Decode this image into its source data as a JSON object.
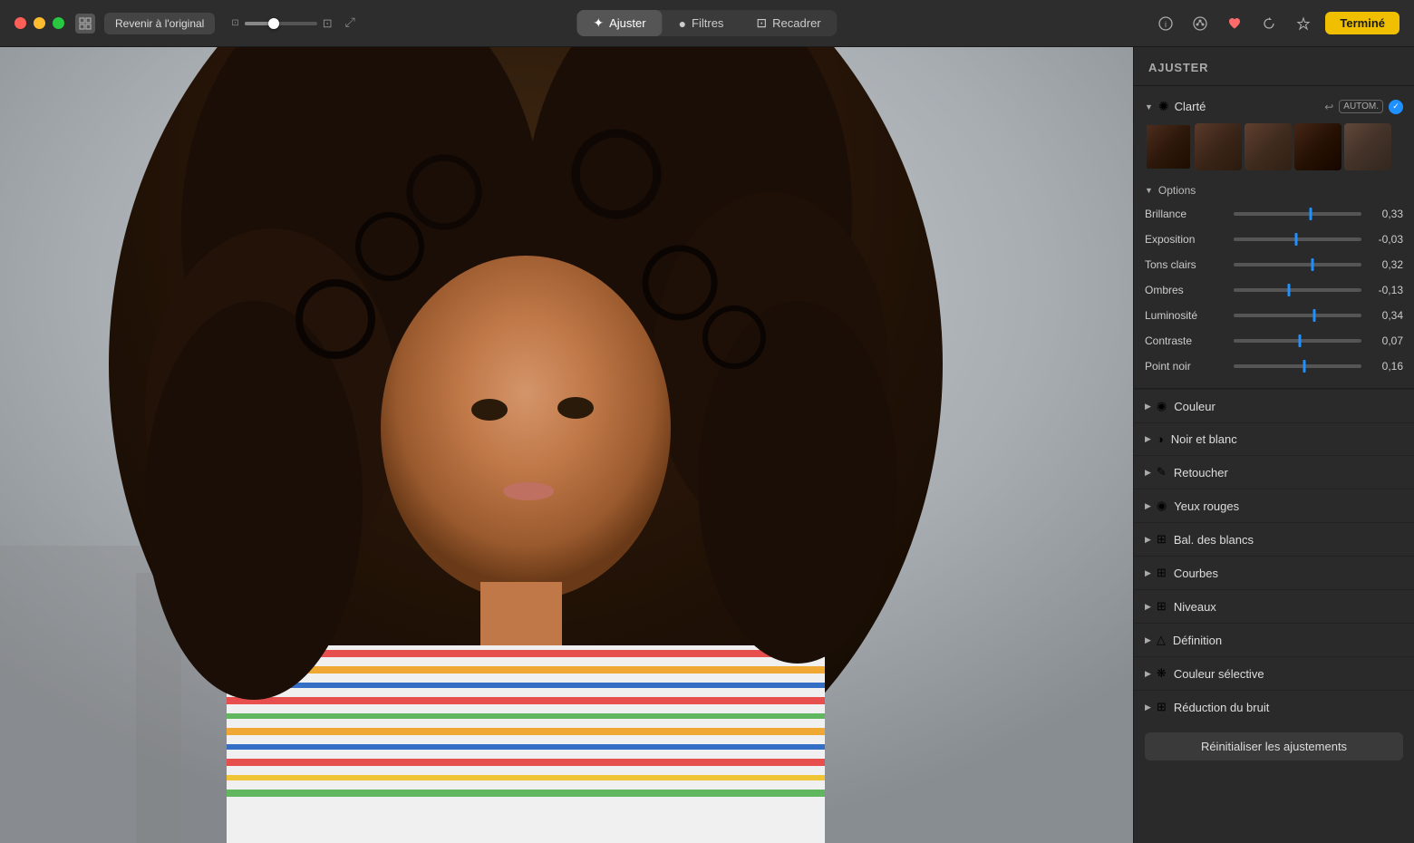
{
  "titlebar": {
    "revert_label": "Revenir à l'original",
    "tabs": [
      {
        "id": "ajuster",
        "label": "Ajuster",
        "icon": "✦",
        "active": true
      },
      {
        "id": "filtres",
        "label": "Filtres",
        "icon": "●"
      },
      {
        "id": "recadrer",
        "label": "Recadrer",
        "icon": "⊡"
      }
    ],
    "done_label": "Terminé"
  },
  "panel": {
    "title": "AJUSTER",
    "clarte": {
      "label": "Clarté",
      "icon": "✺",
      "autom": "AUTOM.",
      "options_label": "Options",
      "sliders": [
        {
          "label": "Brillance",
          "value": "0,33",
          "position": 0.6
        },
        {
          "label": "Exposition",
          "value": "-0,03",
          "position": 0.49
        },
        {
          "label": "Tons clairs",
          "value": "0,32",
          "position": 0.62
        },
        {
          "label": "Ombres",
          "value": "-0,13",
          "position": 0.43
        },
        {
          "label": "Luminosité",
          "value": "0,34",
          "position": 0.63
        },
        {
          "label": "Contraste",
          "value": "0,07",
          "position": 0.52
        },
        {
          "label": "Point noir",
          "value": "0,16",
          "position": 0.55
        }
      ]
    },
    "sections": [
      {
        "id": "couleur",
        "label": "Couleur",
        "icon": "◉"
      },
      {
        "id": "noir-blanc",
        "label": "Noir et blanc",
        "icon": "◑"
      },
      {
        "id": "retoucher",
        "label": "Retoucher",
        "icon": "✎"
      },
      {
        "id": "yeux-rouges",
        "label": "Yeux rouges",
        "icon": "◉"
      },
      {
        "id": "bal-blancs",
        "label": "Bal. des blancs",
        "icon": "⊞"
      },
      {
        "id": "courbes",
        "label": "Courbes",
        "icon": "⊞"
      },
      {
        "id": "niveaux",
        "label": "Niveaux",
        "icon": "⊞"
      },
      {
        "id": "definition",
        "label": "Définition",
        "icon": "△"
      },
      {
        "id": "couleur-selective",
        "label": "Couleur sélective",
        "icon": "❋"
      },
      {
        "id": "reduction-bruit",
        "label": "Réduction du bruit",
        "icon": "⊞"
      }
    ],
    "reset_label": "Réinitialiser les ajustements"
  },
  "colors": {
    "accent_blue": "#1e90ff",
    "done_yellow": "#f0c000",
    "panel_bg": "#2a2a2a",
    "titlebar_bg": "#2d2d2d"
  }
}
